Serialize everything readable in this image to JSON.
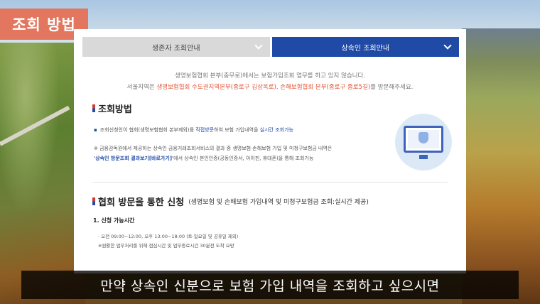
{
  "badge": {
    "label": "조회 방법"
  },
  "tabs": [
    {
      "label": "생존자 조회안내",
      "active": false
    },
    {
      "label": "상속인 조회안내",
      "active": true
    }
  ],
  "intro": {
    "line1": "생명보험협회 본부(충무로)에서는 보험가입조회 업무를 하고 있지 않습니다.",
    "line2_prefix": "서울지역은 ",
    "line2_highlight": "생명보험협회 수도권지역본부(종로구 김상옥로), 손해보험협회 본부(종로구 종로5길)",
    "line2_suffix": "를 방문해주세요."
  },
  "section1": {
    "title": "조회방법",
    "bullet_prefix": "조회신청인이 협회(생명보험협회 본부제외)를 ",
    "bullet_blue1": "직접방문",
    "bullet_mid": "하여 보험 가입내역을 ",
    "bullet_blue2": "실시간 조회가능",
    "note_line1": "※ 금융감독원에서 제공하는 상속인 금융거래조회서비스의 결과 중 생명보험·손해보험 가입 및 미청구보험금 내역은",
    "note_link": "'상속인 방문조회 결과보기[바로가기]'",
    "note_line2_suffix": "에서 상속인 본인인증(공동인증서, 아이핀, 휴대폰)을 통해 조회가능"
  },
  "section2": {
    "title": "협회 방문을 통한 신청",
    "subtitle": "(생명보험 및 손해보험 가입내역 및 미청구보험금 조회:실시간 제공)",
    "step_title": "1. 신청 가능시간",
    "time_line1": "· 오전 09:00~12:00, 오후 13:00~18:00 (토·일요일 및 공휴일 제외)",
    "time_line2": "※원활한 업무처리를 위해 점심시간 및 업무종료시간 30분전 도착 요망"
  },
  "caption": {
    "text": "만약 상속인 신분으로 보험 가입 내역을 조회하고 싶으시면"
  },
  "colors": {
    "badge": "#e2765e",
    "active_tab": "#1f4aa6",
    "highlight": "#e2573a",
    "link": "#1f4aa6"
  }
}
